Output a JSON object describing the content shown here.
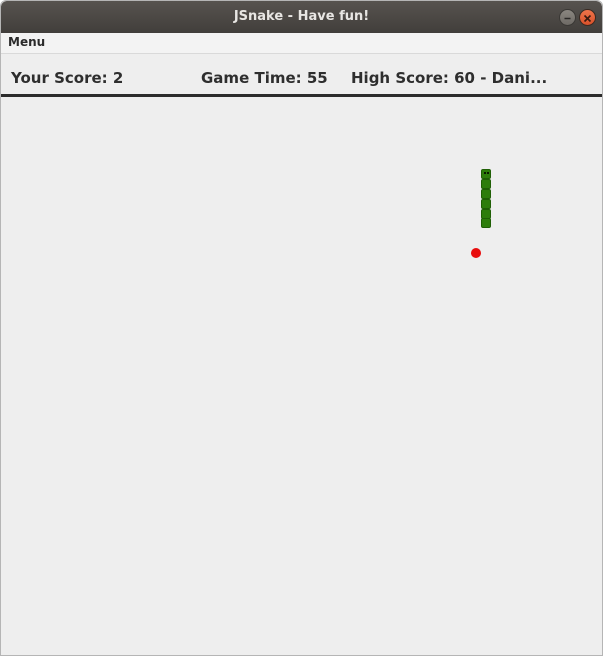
{
  "window": {
    "title": "JSnake - Have fun!"
  },
  "menubar": {
    "menu_label": "Menu"
  },
  "scoreboard": {
    "your_score": "Your Score: 2",
    "game_time": "Game Time: 55",
    "high_score": "High Score: 60 - Dani..."
  },
  "colors": {
    "snake": "#2d7d0b",
    "food": "#e80d0d",
    "background": "#eeeeee",
    "titlebar": "#4a4744",
    "close_button": "#e8643a"
  },
  "icons": {
    "minimize": "minimize-icon",
    "close": "close-icon"
  }
}
